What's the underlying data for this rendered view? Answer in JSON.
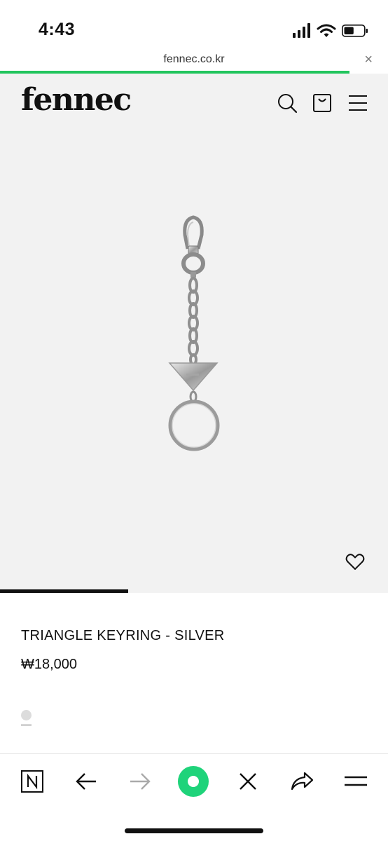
{
  "status_bar": {
    "time": "4:43",
    "battery_level": 0.5
  },
  "browser": {
    "url": "fennec.co.kr",
    "close_glyph": "×",
    "load_progress": 0.9
  },
  "site": {
    "logo": "fennec"
  },
  "product": {
    "name": "TRIANGLE KEYRING - SILVER",
    "price": "₩18,000",
    "color_swatch": "#dcdcdc",
    "gallery_position": 0.33
  },
  "icons": {
    "header": [
      "search-icon",
      "shopping-bag-icon",
      "menu-icon"
    ],
    "toolbar": [
      "naver-n-icon",
      "back-arrow-icon",
      "forward-arrow-icon",
      "green-dot-icon",
      "close-icon",
      "share-icon",
      "menu-icon"
    ]
  },
  "colors": {
    "accent": "#22c55e",
    "page_bg": "#f2f2f2"
  }
}
